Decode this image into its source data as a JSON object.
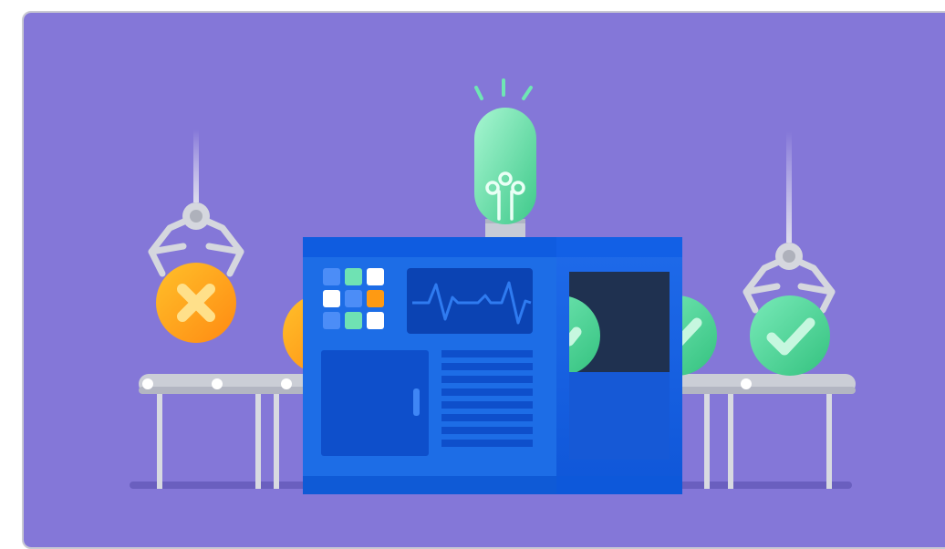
{
  "illustration": {
    "subject": "factory-machine-quality-check",
    "colors": {
      "background": "#8477d8",
      "machine_body": "#1d6de6",
      "machine_dark": "#0f4fc2",
      "belt": "#cbced6",
      "reject_item": "#ff9a12",
      "approved_item": "#4fd69b",
      "bulb": "#6fe6b4",
      "screen": "#0b43b3",
      "window": "#1f3150"
    },
    "icons": [
      "reject-x-icon",
      "approved-check-icon",
      "lightbulb-icon",
      "robotic-claw-icon",
      "heartbeat-line-icon"
    ]
  }
}
